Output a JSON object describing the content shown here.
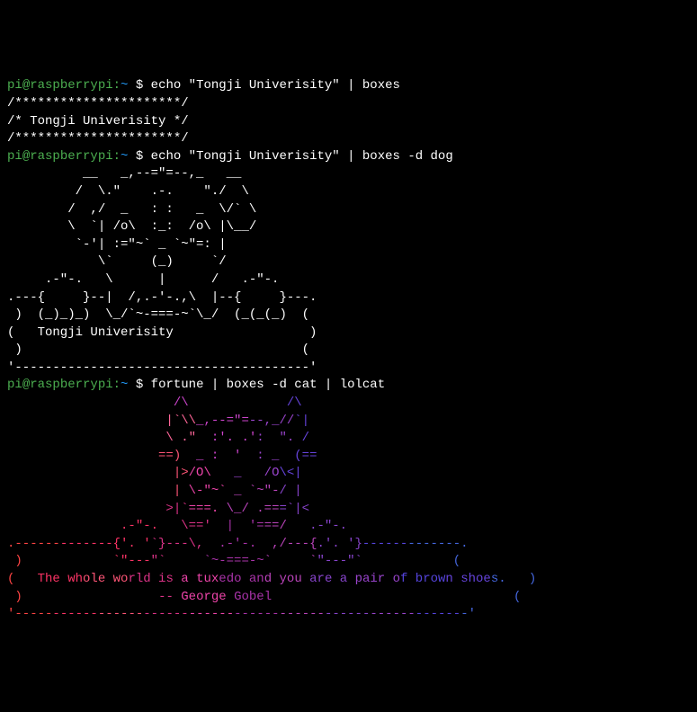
{
  "prompt": {
    "user": "pi",
    "host": "raspberrypi",
    "path": "~",
    "symbol": "$"
  },
  "commands": {
    "cmd1": "echo \"Tongji Univerisity\" | boxes",
    "cmd2": "echo \"Tongji Univerisity\" | boxes -d dog",
    "cmd3": "fortune | boxes -d cat | lolcat"
  },
  "output1": {
    "l1": "/**********************/",
    "l2": "/* Tongji Univerisity */",
    "l3": "/**********************/"
  },
  "output2": {
    "l1": "          __   _,--=\"=--,_   __",
    "l2": "         /  \\.\"    .-.    \"./  \\",
    "l3": "        /  ,/  _   : :   _  \\/` \\",
    "l4": "        \\  `| /o\\  :_:  /o\\ |\\__/",
    "l5": "         `-'| :=\"~` _ `~\"=: |",
    "l6": "            \\`     (_)     `/",
    "l7": "     .-\"-.   \\      |      /   .-\"-.",
    "l8": ".---{     }--|  /,.-'-.,\\  |--{     }---.",
    "l9": " )  (_)_)_)  \\_/`~-===-~`\\_/  (_(_(_)  (",
    "l10": "(   Tongji Univerisity                  )",
    "l11": " )                                     (",
    "l12": "'---------------------------------------'"
  },
  "output3": {
    "l1": "                      /\\             /\\",
    "l2": "                     |`\\\\_,--=\"=--,_//`|",
    "l3": "                     \\ .\"  :'. .':  \". /",
    "l4": "                    ==)  _ :  '  : _  (==",
    "l5": "                      |>/O\\   _   /O\\<|",
    "l6": "                      | \\-\"~` _ `~\"-/ |",
    "l7": "                     >|`===. \\_/ .===`|<",
    "l8": "               .-\"-.   \\==='  |  '===/   .-\"-.",
    "l9": ".-------------{'. '`}---\\,  .-'-.  ,/---{.'. '}-------------.",
    "l10": " )            `\"---\"`     `~-===-~`     `\"---\"`            (",
    "l11": "(   The whole world is a tuxedo and you are a pair of brown shoes.   )",
    "l12": " )                   -- George Gobel                        (",
    "l13": "'-----------------------------------------------------------'"
  },
  "quote": {
    "text": "The whole world is a tuxedo and you are a pair of brown shoes.",
    "author": "-- George Gobel"
  }
}
